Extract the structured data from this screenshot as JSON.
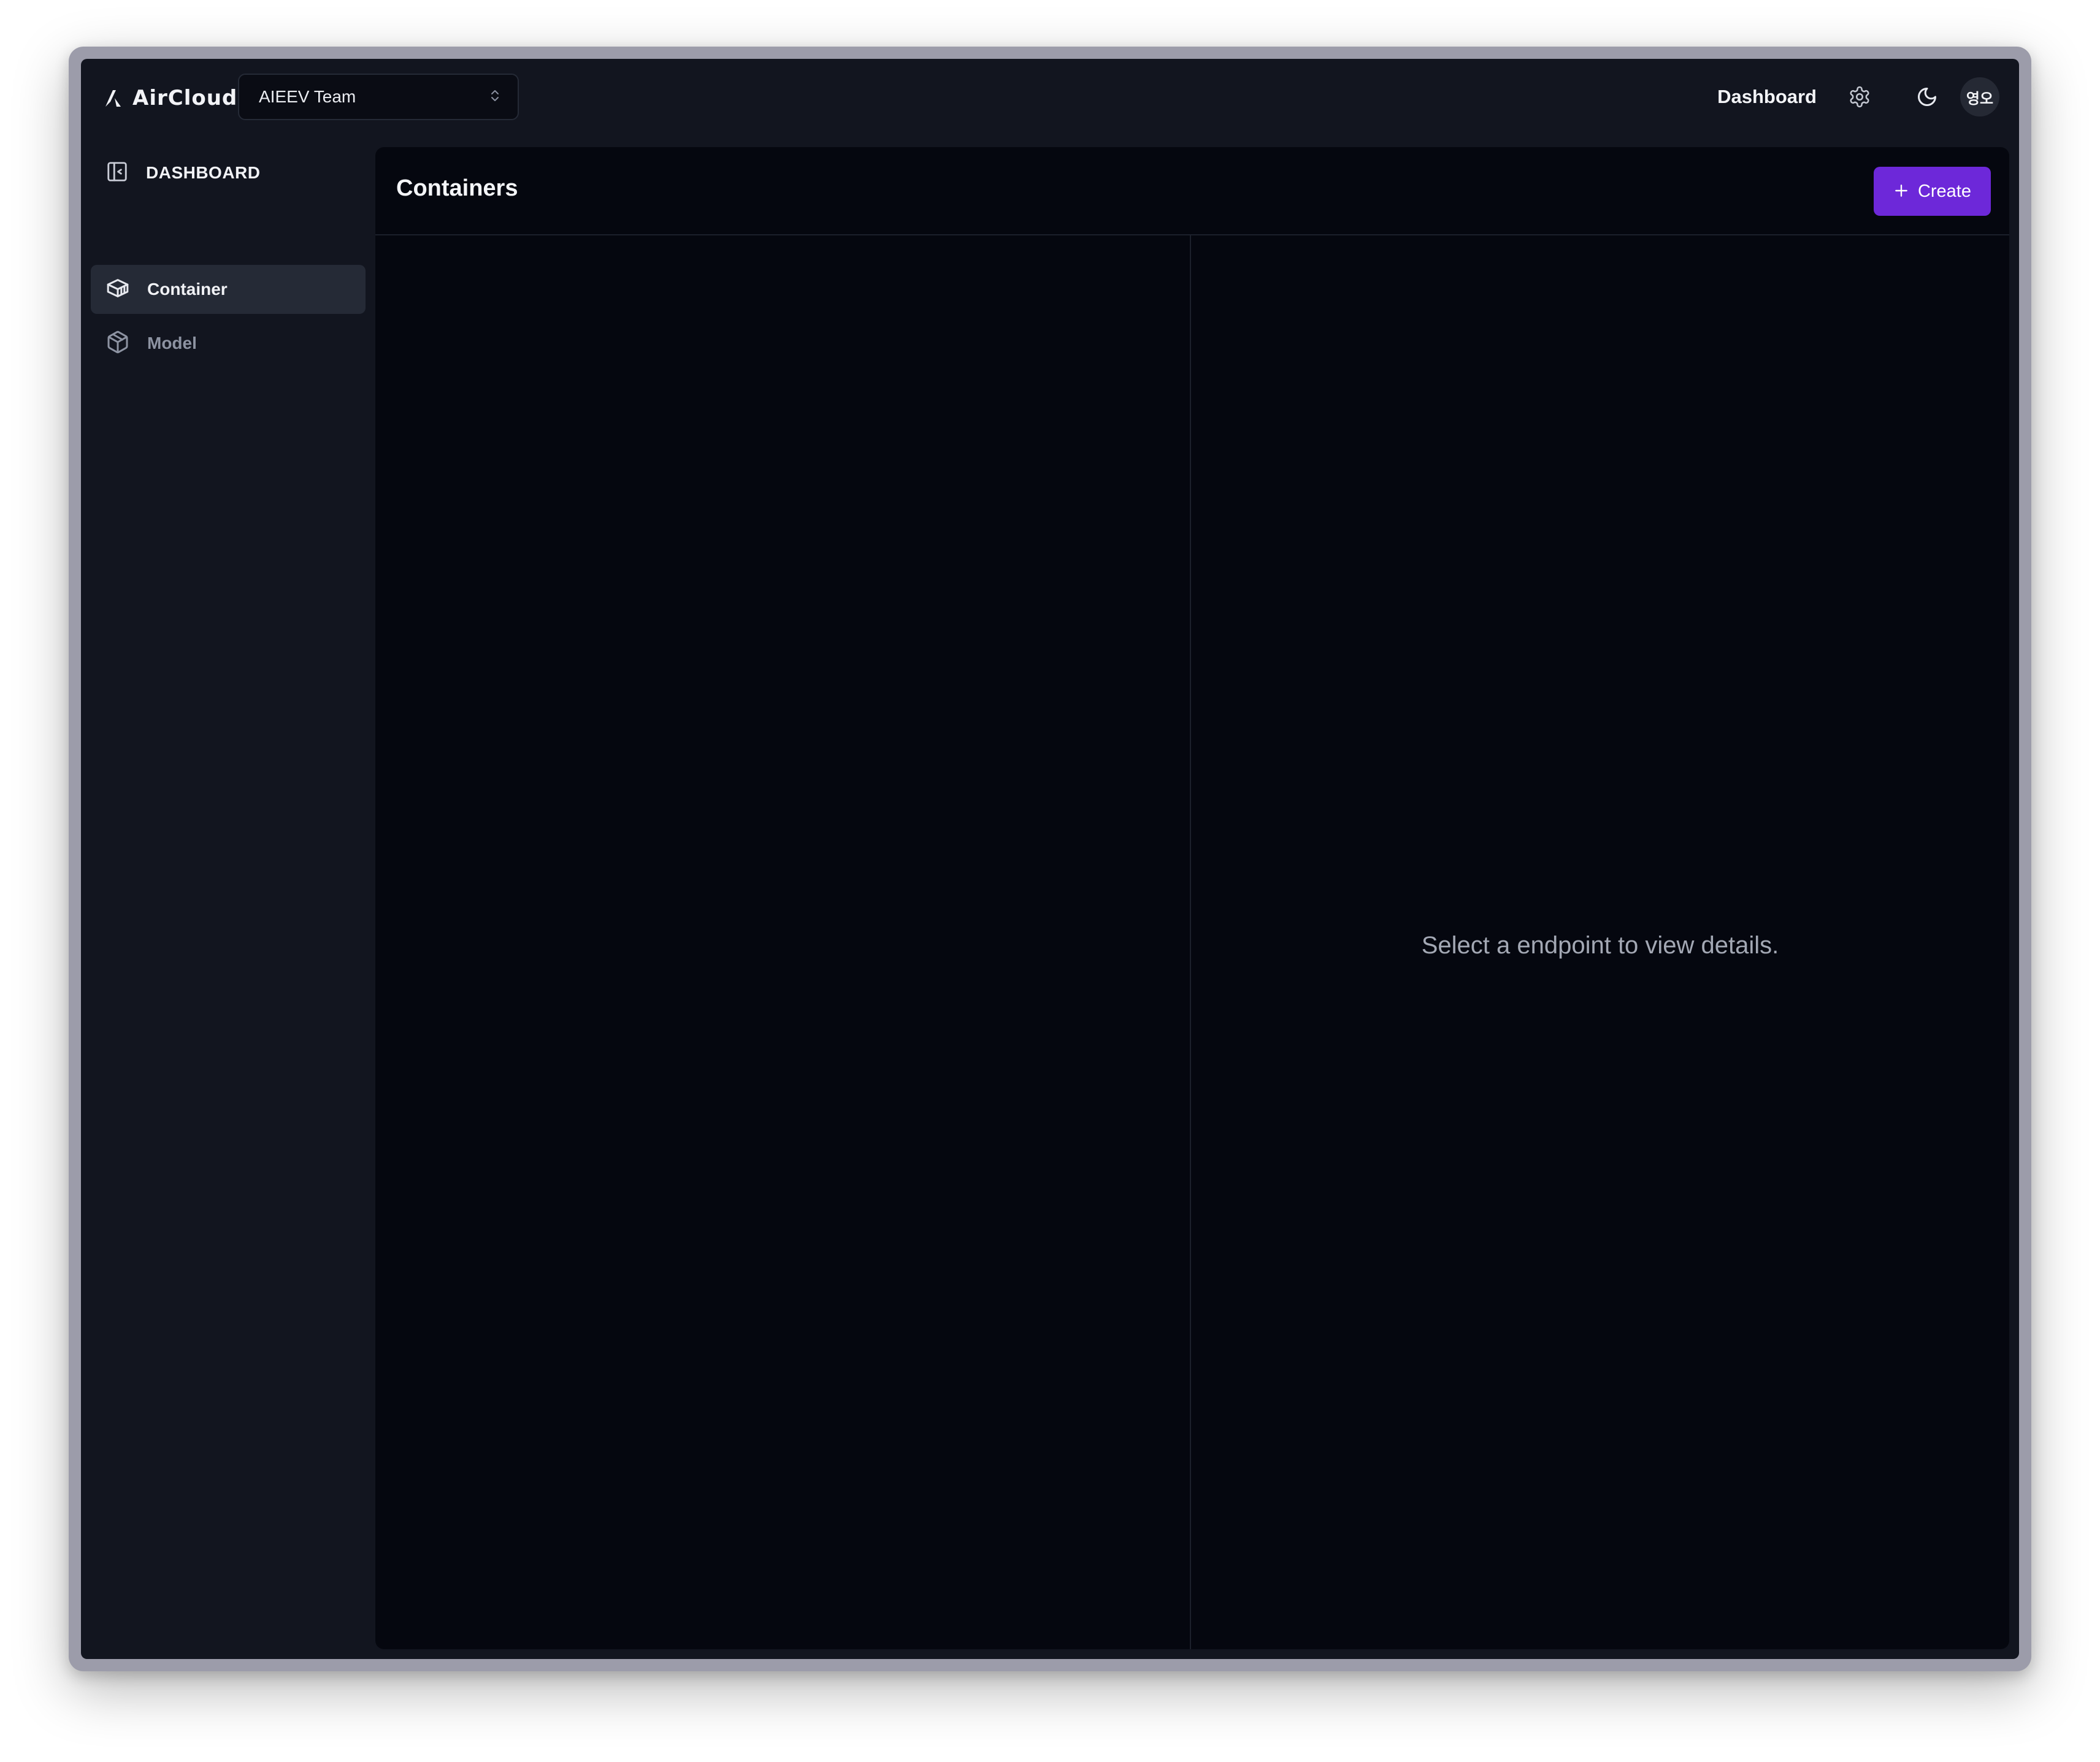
{
  "header": {
    "logo_text": "AirCloud",
    "team_select": {
      "value": "AIEEV Team"
    },
    "nav_link": "Dashboard",
    "avatar_initials": "영오"
  },
  "sidebar": {
    "heading": "DASHBOARD",
    "items": [
      {
        "label": "Container",
        "icon": "container-box-icon",
        "active": true
      },
      {
        "label": "Model",
        "icon": "cube-icon",
        "active": false
      }
    ]
  },
  "main": {
    "title": "Containers",
    "create_label": "Create",
    "detail_empty_message": "Select a endpoint to view details."
  },
  "colors": {
    "accent": "#6d28d9",
    "app_background": "#12151f",
    "panel_background": "#05070f"
  }
}
